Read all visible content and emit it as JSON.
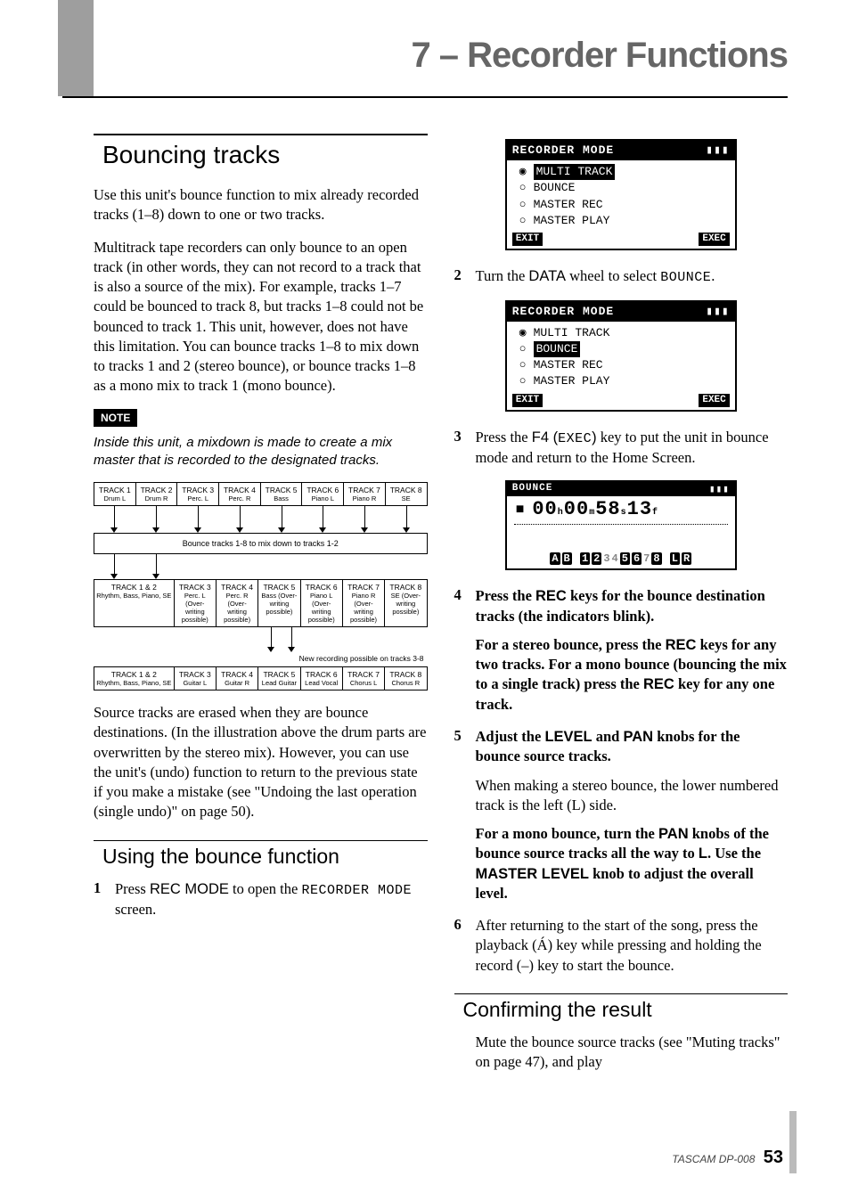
{
  "chapter": {
    "title": "7 – Recorder Functions"
  },
  "left": {
    "h1": "Bouncing tracks",
    "p1": "Use this unit's bounce function to mix already recorded tracks (1–8) down to one or two tracks.",
    "p2": "Multitrack tape recorders can only bounce to an open track (in other words, they can not record to a track that is also a source of the mix). For example, tracks 1–7 could be bounced to track 8, but tracks 1–8 could not be bounced to track 1. This unit, however, does not have this limitation. You can bounce tracks 1–8 to mix down to tracks 1 and 2 (stereo bounce), or bounce tracks 1–8 as a mono mix to track 1 (mono bounce).",
    "note_tag": "NOTE",
    "note_body": "Inside this unit, a mixdown is made to create a mix master that is recorded to the designated tracks.",
    "p3": "Source tracks are erased when they are bounce destinations. (In the illustration above the drum parts are overwritten by the stereo mix). However, you can use the unit's (undo) function to return to the previous state if you make a mistake (see \"Undoing the last operation (single undo)\" on page 50).",
    "h2": "Using the bounce function",
    "step1_pre": "Press ",
    "step1_sans": "REC MODE",
    "step1_mid": " to open the ",
    "step1_mono": "RECORDER MODE",
    "step1_post": " screen.",
    "diagram": {
      "row1": [
        {
          "t": "TRACK 1",
          "s": "Drum L"
        },
        {
          "t": "TRACK 2",
          "s": "Drum R"
        },
        {
          "t": "TRACK 3",
          "s": "Perc. L"
        },
        {
          "t": "TRACK 4",
          "s": "Perc. R"
        },
        {
          "t": "TRACK 5",
          "s": "Bass"
        },
        {
          "t": "TRACK 6",
          "s": "Piano L"
        },
        {
          "t": "TRACK 7",
          "s": "Piano R"
        },
        {
          "t": "TRACK 8",
          "s": "SE"
        }
      ],
      "mix_label": "Bounce tracks 1-8 to mix down to tracks 1-2",
      "row2": [
        {
          "t": "TRACK 1 & 2",
          "s": "Rhythm, Bass, Piano, SE",
          "wide": true
        },
        {
          "t": "TRACK 3",
          "s": "Perc. L (Over-writing possible)"
        },
        {
          "t": "TRACK 4",
          "s": "Perc. R (Over-writing possible)"
        },
        {
          "t": "TRACK 5",
          "s": "Bass (Over-writing possible)"
        },
        {
          "t": "TRACK 6",
          "s": "Piano L (Over-writing possible)"
        },
        {
          "t": "TRACK 7",
          "s": "Piano R (Over-writing possible)"
        },
        {
          "t": "TRACK 8",
          "s": "SE (Over-writing possible)"
        }
      ],
      "new_label": "New recording possible on tracks 3-8",
      "row3": [
        {
          "t": "TRACK 1 & 2",
          "s": "Rhythm, Bass, Piano, SE",
          "wide": true
        },
        {
          "t": "TRACK 3",
          "s": "Guitar L"
        },
        {
          "t": "TRACK 4",
          "s": "Guitar R"
        },
        {
          "t": "TRACK 5",
          "s": "Lead Guitar"
        },
        {
          "t": "TRACK 6",
          "s": "Lead Vocal"
        },
        {
          "t": "TRACK 7",
          "s": "Chorus L"
        },
        {
          "t": "TRACK 8",
          "s": "Chorus R"
        }
      ]
    }
  },
  "right": {
    "lcd1": {
      "title": "RECORDER MODE",
      "batt": "▮▮▮",
      "items": [
        "MULTI TRACK",
        "BOUNCE",
        "MASTER REC",
        "MASTER PLAY"
      ],
      "selected": 0,
      "highlight": 0,
      "exit": "EXIT",
      "exec": "EXEC"
    },
    "step2_pre": "Turn the ",
    "step2_sans": "DATA",
    "step2_mid": " wheel to select ",
    "step2_mono": "BOUNCE",
    "step2_post": ".",
    "lcd2": {
      "title": "RECORDER MODE",
      "batt": "▮▮▮",
      "items": [
        "MULTI TRACK",
        "BOUNCE",
        "MASTER REC",
        "MASTER PLAY"
      ],
      "selected": 0,
      "highlight": 1,
      "exit": "EXIT",
      "exec": "EXEC"
    },
    "step3_pre": "Press the ",
    "step3_sans": "F4 (",
    "step3_mono": "EXEC",
    "step3_sans2": ")",
    "step3_post": " key to put the unit in bounce mode and return to the Home Screen.",
    "lcd3": {
      "title": "BOUNCE",
      "batt": "▮▮▮",
      "stop": "■",
      "h": "00",
      "m": "00",
      "s": "58",
      "f": "13",
      "hl": "h",
      "ml": "m",
      "sl": "s",
      "fl": "f",
      "footer_dark": [
        "A",
        "B"
      ],
      "footer_gray": [
        "1",
        "2",
        "3",
        "4",
        "5",
        "6",
        "7",
        "8"
      ],
      "footer_dark2": [
        "L",
        "R"
      ]
    },
    "step4_a": "Press the ",
    "step4_sans": "REC",
    "step4_b": " keys for the bounce destination tracks (the indicators blink).",
    "step4_c1": "For a stereo bounce, press the ",
    "step4_c_sans": "REC",
    "step4_c2": " keys for any two tracks. For a mono bounce (bouncing the mix to a single track) press the ",
    "step4_c_sans2": "REC",
    "step4_c3": " key for any one track.",
    "step5_a": "Adjust the ",
    "step5_sans1": "LEVEL",
    "step5_b": " and ",
    "step5_sans2": "PAN",
    "step5_c": " knobs for the bounce source tracks.",
    "step5_cont": "When making a stereo bounce, the lower numbered track is the left (L) side.",
    "step5_d1": "For a mono bounce, turn the ",
    "step5_d_sans1": "PAN",
    "step5_d2": " knobs of the bounce source tracks all the way to ",
    "step5_d_sans2": "L",
    "step5_d3": ". Use the ",
    "step5_d_sans3": "MASTER LEVEL",
    "step5_d4": " knob to adjust the overall level.",
    "step6": "After returning to the start of the song, press the playback (Á) key while pressing and holding the record (–) key to start the bounce.",
    "h2": "Confirming the result",
    "conf_body": "Mute the bounce source tracks (see \"Muting tracks\" on page 47), and play"
  },
  "footer": {
    "model": "TASCAM  DP-008",
    "page": "53"
  }
}
